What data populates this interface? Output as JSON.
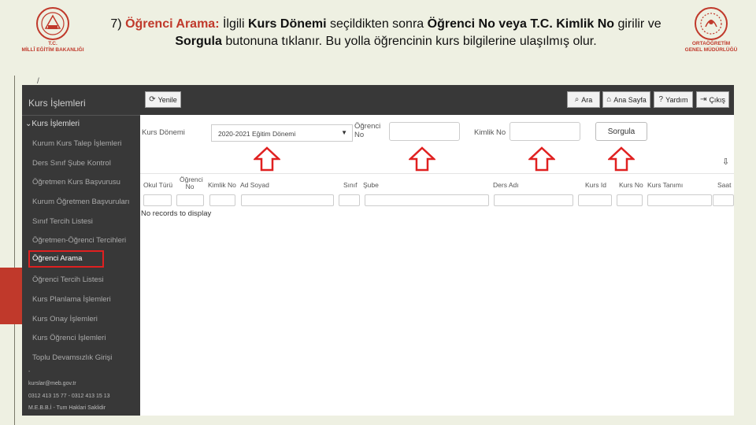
{
  "slide": {
    "caption": {
      "num": "7) ",
      "title": "Öğrenci Arama:",
      "t1": " İlgili ",
      "b1": "Kurs Dönemi",
      "t2": " seçildikten sonra ",
      "b2": "Öğrenci No veya T.C. Kimlik No",
      "t3": " girilir ve ",
      "b3": "Sorgula",
      "t4": " butonuna tıklanır. Bu yolla öğrencinin kurs bilgilerine ulaşılmış olur."
    },
    "logo_left_text": [
      "T.C.",
      "MİLLÎ EĞİTİM BAKANLIĞI"
    ],
    "logo_right_text": [
      "ORTAÖĞRETİM",
      "GENEL MÜDÜRLÜĞÜ"
    ],
    "slide_mark": "/"
  },
  "sidebar": {
    "title": "Kurs İşlemleri",
    "group": "Kurs İşlemleri",
    "items": [
      "Kurum Kurs Talep İşlemleri",
      "Ders Sınıf Şube Kontrol",
      "Öğretmen Kurs Başvurusu",
      "Kurum Öğretmen Başvuruları",
      "Sınıf Tercih Listesi",
      "Öğretmen-Öğrenci Tercihleri",
      "Öğrenci Arama",
      "Öğrenci Tercih Listesi",
      "Kurs Planlama İşlemleri",
      "Kurs Onay İşlemleri",
      "Kurs Öğrenci İşlemleri",
      "Toplu Devamsızlık Girişi"
    ],
    "active_index": 6,
    "footer": {
      "dash": "-",
      "email": "kurslar@meb.gov.tr",
      "phone": "0312 413 15 77 - 0312 413 15 13",
      "credit": "M.E.B.B.İ - Tum Haklari Saklidir"
    }
  },
  "toolbar": {
    "refresh": "Yenile",
    "search": "Ara",
    "home": "Ana Sayfa",
    "help": "Yardım",
    "exit": "Çıkış"
  },
  "filters": {
    "period_label": "Kurs Dönemi",
    "period_value": "2020-2021 Eğitim Dönemi",
    "student_no_label_1": "Öğrenci",
    "student_no_label_2": "No",
    "student_no_value": "",
    "tc_label": "Kimlik No",
    "tc_value": "",
    "query_button": "Sorgula"
  },
  "grid": {
    "columns": [
      "Okul Türü",
      "Öğrenci No",
      "Kimlik No",
      "Ad Soyad",
      "Sınıf",
      "Şube",
      "Ders Adı",
      "Kurs Id",
      "Kurs No",
      "Kurs Tanımı",
      "Saat"
    ],
    "empty_text": "No records to display"
  },
  "colors": {
    "accent_red": "#e02020",
    "sidebar_bg": "#383838"
  }
}
